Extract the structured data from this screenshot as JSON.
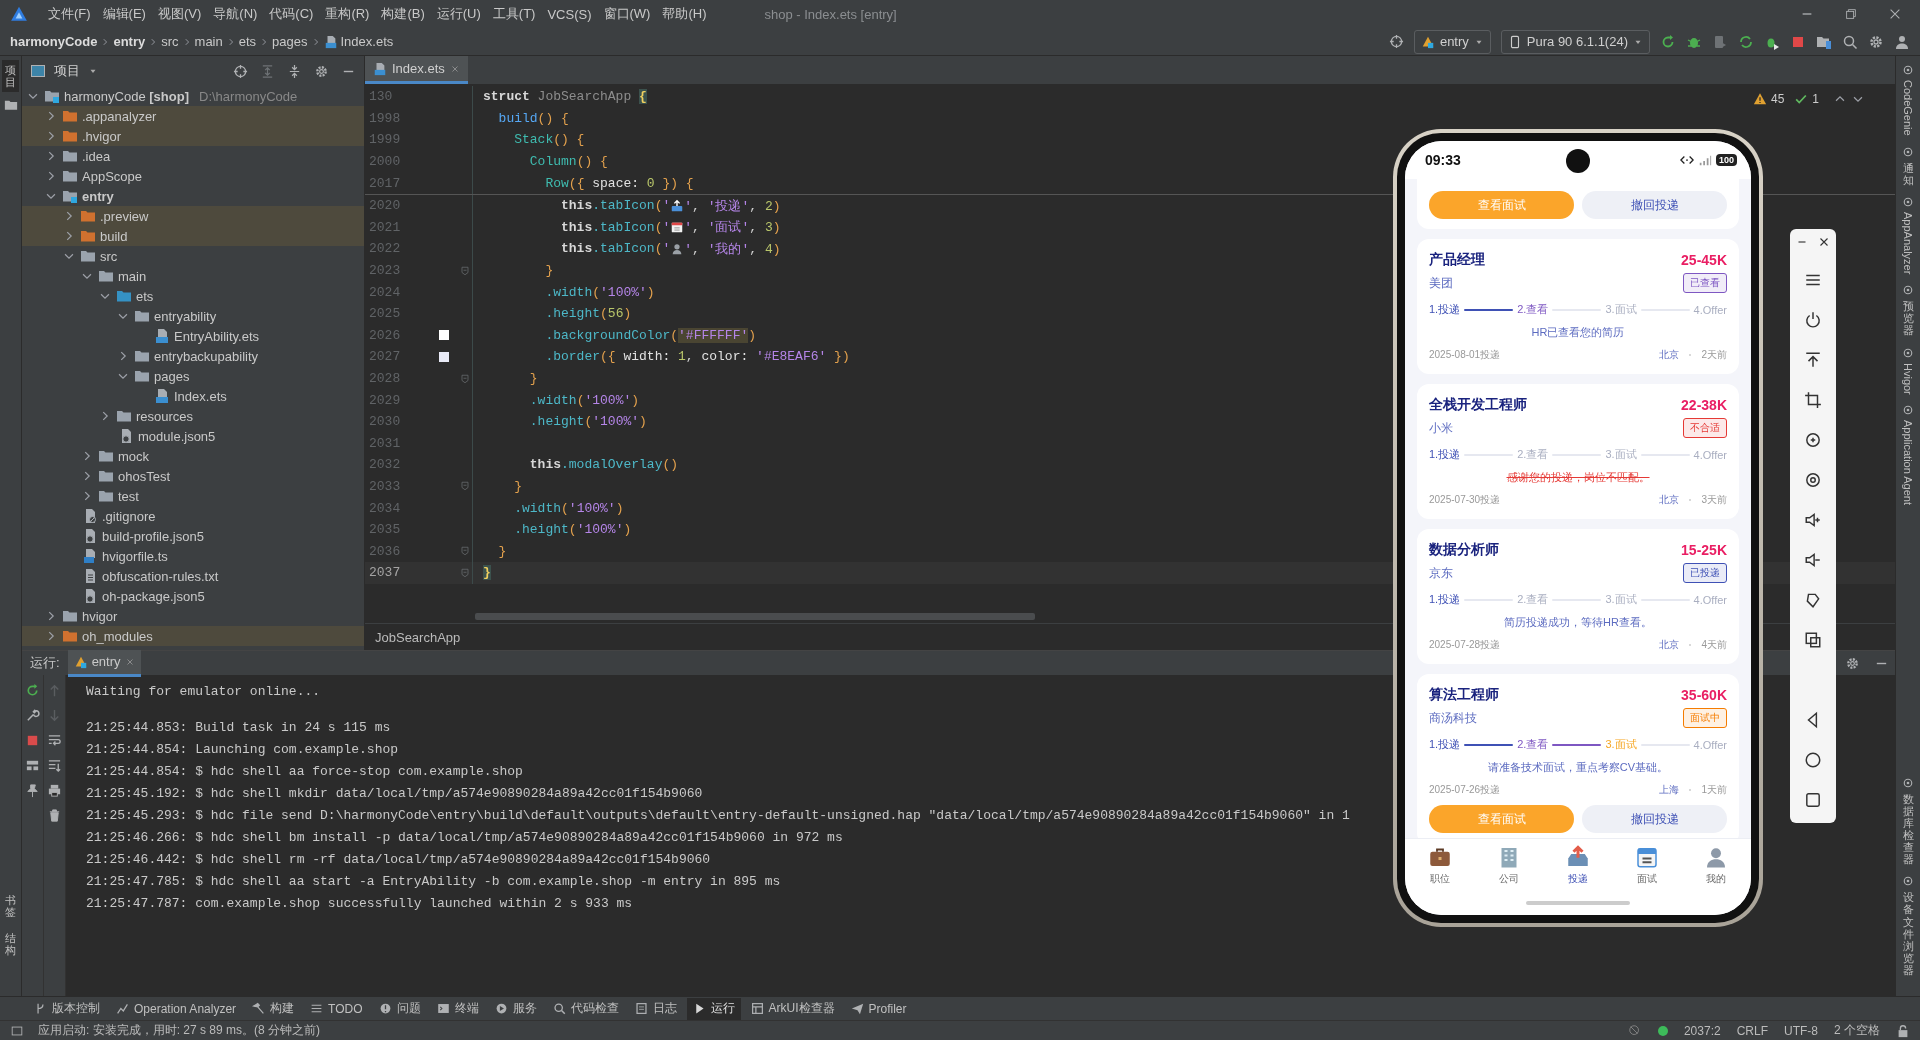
{
  "menubar": {
    "items": [
      "文件(F)",
      "编辑(E)",
      "视图(V)",
      "导航(N)",
      "代码(C)",
      "重构(R)",
      "构建(B)",
      "运行(U)",
      "工具(T)",
      "VCS(S)",
      "窗口(W)",
      "帮助(H)"
    ],
    "title": "shop - Index.ets [entry]"
  },
  "navbar": {
    "breadcrumb": [
      {
        "label": "harmonyCode",
        "kind": "project"
      },
      {
        "label": "entry",
        "kind": "module"
      },
      {
        "label": "src",
        "kind": "dir"
      },
      {
        "label": "main",
        "kind": "dir"
      },
      {
        "label": "ets",
        "kind": "dir"
      },
      {
        "label": "pages",
        "kind": "dir"
      },
      {
        "label": "Index.ets",
        "kind": "file"
      }
    ],
    "run_config": "entry",
    "device": "Pura 90 6.1.1(24)"
  },
  "left_strip": {
    "top": [
      {
        "label": "项目",
        "selected": true
      }
    ],
    "bottom": [
      {
        "label": "书签",
        "selected": false
      },
      {
        "label": "结构",
        "selected": false
      }
    ]
  },
  "project": {
    "title": "项目",
    "tree": [
      {
        "label": "harmonyCode **[shop]**",
        "path": "D:\\harmonyCode",
        "kind": "project",
        "expanded": true,
        "children": [
          {
            "label": ".appanalyzer",
            "kind": "excluded",
            "expanded": false
          },
          {
            "label": ".hvigor",
            "kind": "excluded",
            "expanded": false
          },
          {
            "label": ".idea",
            "kind": "folder",
            "expanded": false
          },
          {
            "label": "AppScope",
            "kind": "folder",
            "expanded": false
          },
          {
            "label": "entry",
            "kind": "module",
            "expanded": true,
            "children": [
              {
                "label": ".preview",
                "kind": "excluded",
                "expanded": false
              },
              {
                "label": "build",
                "kind": "excluded",
                "expanded": false
              },
              {
                "label": "src",
                "kind": "folder",
                "expanded": true,
                "children": [
                  {
                    "label": "main",
                    "kind": "folder",
                    "expanded": true,
                    "children": [
                      {
                        "label": "ets",
                        "kind": "source",
                        "expanded": true,
                        "children": [
                          {
                            "label": "entryability",
                            "kind": "folder",
                            "expanded": true,
                            "children": [
                              {
                                "label": "EntryAbility.ets",
                                "kind": "ets"
                              }
                            ]
                          },
                          {
                            "label": "entrybackupability",
                            "kind": "folder",
                            "expanded": false
                          },
                          {
                            "label": "pages",
                            "kind": "folder",
                            "expanded": true,
                            "children": [
                              {
                                "label": "Index.ets",
                                "kind": "ets"
                              }
                            ]
                          }
                        ]
                      },
                      {
                        "label": "resources",
                        "kind": "folder",
                        "expanded": false
                      },
                      {
                        "label": "module.json5",
                        "kind": "json"
                      }
                    ]
                  },
                  {
                    "label": "mock",
                    "kind": "folder",
                    "expanded": false
                  },
                  {
                    "label": "ohosTest",
                    "kind": "folder",
                    "expanded": false
                  },
                  {
                    "label": "test",
                    "kind": "folder",
                    "expanded": false
                  }
                ]
              },
              {
                "label": ".gitignore",
                "kind": "ignore"
              },
              {
                "label": "build-profile.json5",
                "kind": "json"
              },
              {
                "label": "hvigorfile.ts",
                "kind": "ts"
              },
              {
                "label": "obfuscation-rules.txt",
                "kind": "txt"
              },
              {
                "label": "oh-package.json5",
                "kind": "json"
              }
            ]
          },
          {
            "label": "hvigor",
            "kind": "folder",
            "expanded": false
          },
          {
            "label": "oh_modules",
            "kind": "excluded",
            "expanded": false
          }
        ]
      }
    ]
  },
  "editor": {
    "tabs": [
      {
        "label": "Index.ets",
        "selected": true
      }
    ],
    "warnings": "45",
    "passed": "1",
    "sticky": [
      {
        "number": "130",
        "tokens": [
          {
            "kind": "kw",
            "text": "struct "
          },
          {
            "kind": "cls",
            "text": "JobSearchApp "
          },
          {
            "kind": "match",
            "text": "{"
          }
        ]
      },
      {
        "number": "1998",
        "tokens": [
          {
            "kind": "def",
            "text": "  build"
          },
          {
            "kind": "brace",
            "text": "() {"
          }
        ]
      },
      {
        "number": "1999",
        "tokens": [
          {
            "kind": "comp",
            "text": "    Stack"
          },
          {
            "kind": "brace",
            "text": "() {"
          }
        ]
      },
      {
        "number": "2000",
        "tokens": [
          {
            "kind": "comp",
            "text": "      Column"
          },
          {
            "kind": "brace",
            "text": "() {"
          }
        ]
      },
      {
        "number": "2017",
        "tokens": [
          {
            "kind": "comp",
            "text": "        Row"
          },
          {
            "kind": "brace",
            "text": "({ "
          },
          {
            "kind": "prop",
            "text": "space: "
          },
          {
            "kind": "num",
            "text": "0"
          },
          {
            "kind": "brace",
            "text": " }) {"
          }
        ]
      }
    ],
    "lines": [
      {
        "number": "2020",
        "fold": false,
        "current": false,
        "tokens": [
          {
            "kind": "kw",
            "text": "          this"
          },
          {
            "kind": "fn",
            "text": ".tabIcon"
          },
          {
            "kind": "brace",
            "text": "("
          },
          {
            "kind": "str",
            "text": "'"
          },
          {
            "kind": "tray"
          },
          {
            "kind": "str",
            "text": "'"
          },
          {
            "kind": "p",
            "text": ", "
          },
          {
            "kind": "str",
            "text": "'投递'"
          },
          {
            "kind": "p",
            "text": ", "
          },
          {
            "kind": "num",
            "text": "2"
          },
          {
            "kind": "brace",
            "text": ")"
          }
        ]
      },
      {
        "number": "2021",
        "fold": false,
        "current": false,
        "tokens": [
          {
            "kind": "kw",
            "text": "          this"
          },
          {
            "kind": "fn",
            "text": ".tabIcon"
          },
          {
            "kind": "brace",
            "text": "("
          },
          {
            "kind": "str",
            "text": "'"
          },
          {
            "kind": "calendar"
          },
          {
            "kind": "str",
            "text": "'"
          },
          {
            "kind": "p",
            "text": ", "
          },
          {
            "kind": "str",
            "text": "'面试'"
          },
          {
            "kind": "p",
            "text": ", "
          },
          {
            "kind": "num",
            "text": "3"
          },
          {
            "kind": "brace",
            "text": ")"
          }
        ]
      },
      {
        "number": "2022",
        "fold": false,
        "current": false,
        "tokens": [
          {
            "kind": "kw",
            "text": "          this"
          },
          {
            "kind": "fn",
            "text": ".tabIcon"
          },
          {
            "kind": "brace",
            "text": "("
          },
          {
            "kind": "str",
            "text": "'"
          },
          {
            "kind": "person"
          },
          {
            "kind": "str",
            "text": "'"
          },
          {
            "kind": "p",
            "text": ", "
          },
          {
            "kind": "str",
            "text": "'我的'"
          },
          {
            "kind": "p",
            "text": ", "
          },
          {
            "kind": "num",
            "text": "4"
          },
          {
            "kind": "brace",
            "text": ")"
          }
        ]
      },
      {
        "number": "2023",
        "fold": true,
        "current": false,
        "tokens": [
          {
            "kind": "brace",
            "text": "        }"
          }
        ]
      },
      {
        "number": "2024",
        "fold": false,
        "current": false,
        "tokens": [
          {
            "kind": "fn",
            "text": "        .width"
          },
          {
            "kind": "brace",
            "text": "("
          },
          {
            "kind": "str",
            "text": "'100%'"
          },
          {
            "kind": "brace",
            "text": ")"
          }
        ]
      },
      {
        "number": "2025",
        "fold": false,
        "current": false,
        "tokens": [
          {
            "kind": "fn",
            "text": "        .height"
          },
          {
            "kind": "brace",
            "text": "("
          },
          {
            "kind": "num",
            "text": "56"
          },
          {
            "kind": "brace",
            "text": ")"
          }
        ]
      },
      {
        "number": "2026",
        "fold": false,
        "current": false,
        "color": "#ffffff",
        "tokens": [
          {
            "kind": "fn",
            "text": "        .backgroundColor"
          },
          {
            "kind": "brace",
            "text": "("
          },
          {
            "kind": "strhl",
            "text": "'#FFFFFF'"
          },
          {
            "kind": "brace",
            "text": ")"
          }
        ]
      },
      {
        "number": "2027",
        "fold": false,
        "current": false,
        "color": "#e8eaf6",
        "tokens": [
          {
            "kind": "fn",
            "text": "        .border"
          },
          {
            "kind": "brace",
            "text": "({ "
          },
          {
            "kind": "prop",
            "text": "width: "
          },
          {
            "kind": "num",
            "text": "1"
          },
          {
            "kind": "p",
            "text": ", "
          },
          {
            "kind": "prop",
            "text": "color: "
          },
          {
            "kind": "str",
            "text": "'#E8EAF6'"
          },
          {
            "kind": "brace",
            "text": " })"
          }
        ]
      },
      {
        "number": "2028",
        "fold": true,
        "current": false,
        "tokens": [
          {
            "kind": "brace",
            "text": "      }"
          }
        ]
      },
      {
        "number": "2029",
        "fold": false,
        "current": false,
        "tokens": [
          {
            "kind": "fn",
            "text": "      .width"
          },
          {
            "kind": "brace",
            "text": "("
          },
          {
            "kind": "str",
            "text": "'100%'"
          },
          {
            "kind": "brace",
            "text": ")"
          }
        ]
      },
      {
        "number": "2030",
        "fold": false,
        "current": false,
        "tokens": [
          {
            "kind": "fn",
            "text": "      .height"
          },
          {
            "kind": "brace",
            "text": "("
          },
          {
            "kind": "str",
            "text": "'100%'"
          },
          {
            "kind": "brace",
            "text": ")"
          }
        ]
      },
      {
        "number": "2031",
        "fold": false,
        "current": false
      },
      {
        "number": "2032",
        "fold": false,
        "current": false,
        "tokens": [
          {
            "kind": "kw",
            "text": "      this"
          },
          {
            "kind": "fn",
            "text": ".modalOverlay"
          },
          {
            "kind": "brace",
            "text": "()"
          }
        ]
      },
      {
        "number": "2033",
        "fold": true,
        "current": false,
        "tokens": [
          {
            "kind": "brace",
            "text": "    }"
          }
        ]
      },
      {
        "number": "2034",
        "fold": false,
        "current": false,
        "tokens": [
          {
            "kind": "fn",
            "text": "    .width"
          },
          {
            "kind": "brace",
            "text": "("
          },
          {
            "kind": "str",
            "text": "'100%'"
          },
          {
            "kind": "brace",
            "text": ")"
          }
        ]
      },
      {
        "number": "2035",
        "fold": false,
        "current": false,
        "tokens": [
          {
            "kind": "fn",
            "text": "    .height"
          },
          {
            "kind": "brace",
            "text": "("
          },
          {
            "kind": "str",
            "text": "'100%'"
          },
          {
            "kind": "brace",
            "text": ")"
          }
        ]
      },
      {
        "number": "2036",
        "fold": true,
        "current": false,
        "tokens": [
          {
            "kind": "brace",
            "text": "  }"
          }
        ]
      },
      {
        "number": "2037",
        "fold": true,
        "current": true,
        "tokens": [
          {
            "kind": "match",
            "text": "}"
          }
        ]
      }
    ],
    "breadcrumb": "JobSearchApp"
  },
  "run": {
    "label": "运行:",
    "tabs": [
      {
        "label": "entry",
        "selected": true
      }
    ],
    "blocks": [
      [
        "Waiting for emulator online..."
      ],
      [
        "21:25:44.853: Build task in 24 s 115 ms",
        "21:25:44.854: Launching com.example.shop",
        "21:25:44.854: $ hdc shell aa force-stop com.example.shop",
        "21:25:45.192: $ hdc shell mkdir data/local/tmp/a574e90890284a89a42cc01f154b9060",
        "21:25:45.293: $ hdc file send D:\\harmonyCode\\entry\\build\\default\\outputs\\default\\entry-default-unsigned.hap \"data/local/tmp/a574e90890284a89a42cc01f154b9060\" in 1",
        "21:25:46.266: $ hdc shell bm install -p data/local/tmp/a574e90890284a89a42cc01f154b9060 in 972 ms",
        "21:25:46.442: $ hdc shell rm -rf data/local/tmp/a574e90890284a89a42cc01f154b9060",
        "21:25:47.785: $ hdc shell aa start -a EntryAbility -b com.example.shop -m entry in 895 ms",
        "21:25:47.787: com.example.shop successfully launched within 2 s 933 ms"
      ]
    ]
  },
  "right_strip": {
    "top": [
      {
        "label": "CodeGenie",
        "kind": "rotated"
      },
      {
        "label": "通知",
        "kind": "stacked"
      },
      {
        "label": "AppAnalyzer",
        "kind": "rotated"
      },
      {
        "label": "预览器",
        "kind": "stacked"
      },
      {
        "label": "Hvigor",
        "kind": "rotated"
      },
      {
        "label": "Application Agent",
        "kind": "rotated"
      }
    ],
    "bottom": [
      {
        "label": "数据库检查器",
        "kind": "stacked"
      },
      {
        "label": "设备文件浏览器",
        "kind": "stacked"
      }
    ]
  },
  "phone": {
    "time": "09:33",
    "battery": "100",
    "partial_card": {
      "actions": [
        {
          "label": "查看面试",
          "kind": "primary"
        },
        {
          "label": "撤回投递",
          "kind": "secondary"
        }
      ]
    },
    "applications": [
      {
        "title": "产品经理",
        "company": "美团",
        "salary": "25-45K",
        "status": "已查看",
        "color": "#7e57c2",
        "steps": [
          {
            "label": "1.投递",
            "reached": true
          },
          {
            "label": "2.查看",
            "reached": true
          },
          {
            "label": "3.面试",
            "reached": false
          },
          {
            "label": "4.Offer",
            "reached": false
          }
        ],
        "message": "HR已查看您的简历",
        "rejected": false,
        "date": "2025-08-01投递",
        "city": "北京",
        "ago": "2天前"
      },
      {
        "title": "全栈开发工程师",
        "company": "小米",
        "salary": "22-38K",
        "status": "不合适",
        "color": "#e53935",
        "steps": [
          {
            "label": "1.投递",
            "reached": true
          },
          {
            "label": "2.查看",
            "reached": false
          },
          {
            "label": "3.面试",
            "reached": false
          },
          {
            "label": "4.Offer",
            "reached": false
          }
        ],
        "message": "感谢您的投递，岗位不匹配。",
        "rejected": true,
        "date": "2025-07-30投递",
        "city": "北京",
        "ago": "3天前"
      },
      {
        "title": "数据分析师",
        "company": "京东",
        "salary": "15-25K",
        "status": "已投递",
        "color": "#3f51b5",
        "steps": [
          {
            "label": "1.投递",
            "reached": true
          },
          {
            "label": "2.查看",
            "reached": false
          },
          {
            "label": "3.面试",
            "reached": false
          },
          {
            "label": "4.Offer",
            "reached": false
          }
        ],
        "message": "简历投递成功，等待HR查看。",
        "rejected": false,
        "date": "2025-07-28投递",
        "city": "北京",
        "ago": "4天前"
      },
      {
        "title": "算法工程师",
        "company": "商汤科技",
        "salary": "35-60K",
        "status": "面试中",
        "color": "#f57c00",
        "steps": [
          {
            "label": "1.投递",
            "reached": true
          },
          {
            "label": "2.查看",
            "reached": true
          },
          {
            "label": "3.面试",
            "reached": true
          },
          {
            "label": "4.Offer",
            "reached": false
          }
        ],
        "message": "请准备技术面试，重点考察CV基础。",
        "rejected": false,
        "date": "2025-07-26投递",
        "city": "上海",
        "ago": "1天前",
        "actions": [
          {
            "label": "查看面试",
            "kind": "primary"
          },
          {
            "label": "撤回投递",
            "kind": "secondary"
          }
        ]
      }
    ],
    "nav": [
      {
        "label": "职位",
        "kind": "briefcase",
        "selected": false
      },
      {
        "label": "公司",
        "kind": "building",
        "selected": false
      },
      {
        "label": "投递",
        "kind": "tray",
        "selected": true
      },
      {
        "label": "面试",
        "kind": "calendar",
        "selected": false
      },
      {
        "label": "我的",
        "kind": "person",
        "selected": false
      }
    ]
  },
  "tool_windows": [
    {
      "label": "版本控制",
      "selected": false
    },
    {
      "label": "Operation Analyzer",
      "selected": false
    },
    {
      "label": "构建",
      "selected": false
    },
    {
      "label": "TODO",
      "selected": false
    },
    {
      "label": "问题",
      "selected": false
    },
    {
      "label": "终端",
      "selected": false
    },
    {
      "label": "服务",
      "selected": false
    },
    {
      "label": "代码检查",
      "selected": false
    },
    {
      "label": "日志",
      "selected": false
    },
    {
      "label": "运行",
      "selected": true
    },
    {
      "label": "ArkUI检查器",
      "selected": false
    },
    {
      "label": "Profiler",
      "selected": false
    }
  ],
  "status_bar": {
    "message": "应用启动: 安装完成，用时: 27 s 89 ms。(8 分钟之前)",
    "position": "2037:2",
    "line_ending": "CRLF",
    "encoding": "UTF-8",
    "indent": "2 个空格"
  }
}
